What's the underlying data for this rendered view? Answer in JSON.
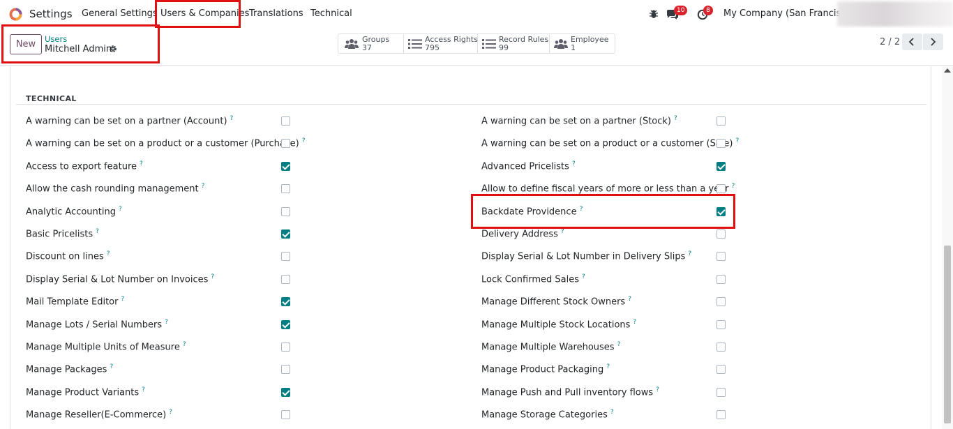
{
  "navbar": {
    "app_name": "Settings",
    "menu": [
      "General Settings",
      "Users & Companies",
      "Translations",
      "Technical"
    ],
    "messages_badge": "10",
    "activities_badge": "8",
    "company": "My Company (San Francisco)"
  },
  "control": {
    "new_label": "New",
    "breadcrumb_parent": "Users",
    "breadcrumb_current": "Mitchell Admin",
    "smart_buttons": [
      {
        "label": "Groups",
        "value": "37",
        "icon": "users-icon"
      },
      {
        "label": "Access Rights",
        "value": "795",
        "icon": "list-icon"
      },
      {
        "label": "Record Rules",
        "value": "99",
        "icon": "list-icon"
      },
      {
        "label": "Employee",
        "value": "1",
        "icon": "users-icon"
      }
    ],
    "pager": "2 / 2"
  },
  "section": {
    "title": "TECHNICAL",
    "left": [
      {
        "label": "A warning can be set on a partner (Account)",
        "checked": false
      },
      {
        "label": "A warning can be set on a product or a customer (Purchase)",
        "checked": false
      },
      {
        "label": "Access to export feature",
        "checked": true
      },
      {
        "label": "Allow the cash rounding management",
        "checked": false
      },
      {
        "label": "Analytic Accounting",
        "checked": false
      },
      {
        "label": "Basic Pricelists",
        "checked": true
      },
      {
        "label": "Discount on lines",
        "checked": false
      },
      {
        "label": "Display Serial & Lot Number on Invoices",
        "checked": false
      },
      {
        "label": "Mail Template Editor",
        "checked": true
      },
      {
        "label": "Manage Lots / Serial Numbers",
        "checked": true
      },
      {
        "label": "Manage Multiple Units of Measure",
        "checked": false
      },
      {
        "label": "Manage Packages",
        "checked": false
      },
      {
        "label": "Manage Product Variants",
        "checked": true
      },
      {
        "label": "Manage Reseller(E-Commerce)",
        "checked": false
      }
    ],
    "right": [
      {
        "label": "A warning can be set on a partner (Stock)",
        "checked": false
      },
      {
        "label": "A warning can be set on a product or a customer (Sale)",
        "checked": false
      },
      {
        "label": "Advanced Pricelists",
        "checked": true
      },
      {
        "label": "Allow to define fiscal years of more or less than a year",
        "checked": false
      },
      {
        "label": "Backdate Providence",
        "checked": true
      },
      {
        "label": "Delivery Address",
        "checked": false
      },
      {
        "label": "Display Serial & Lot Number in Delivery Slips",
        "checked": false
      },
      {
        "label": "Lock Confirmed Sales",
        "checked": false
      },
      {
        "label": "Manage Different Stock Owners",
        "checked": false
      },
      {
        "label": "Manage Multiple Stock Locations",
        "checked": false
      },
      {
        "label": "Manage Multiple Warehouses",
        "checked": false
      },
      {
        "label": "Manage Product Packaging",
        "checked": false
      },
      {
        "label": "Manage Push and Pull inventory flows",
        "checked": false
      },
      {
        "label": "Manage Storage Categories",
        "checked": false
      }
    ]
  },
  "colors": {
    "accent": "#714b67",
    "teal": "#017e84",
    "highlight": "#e01010"
  }
}
